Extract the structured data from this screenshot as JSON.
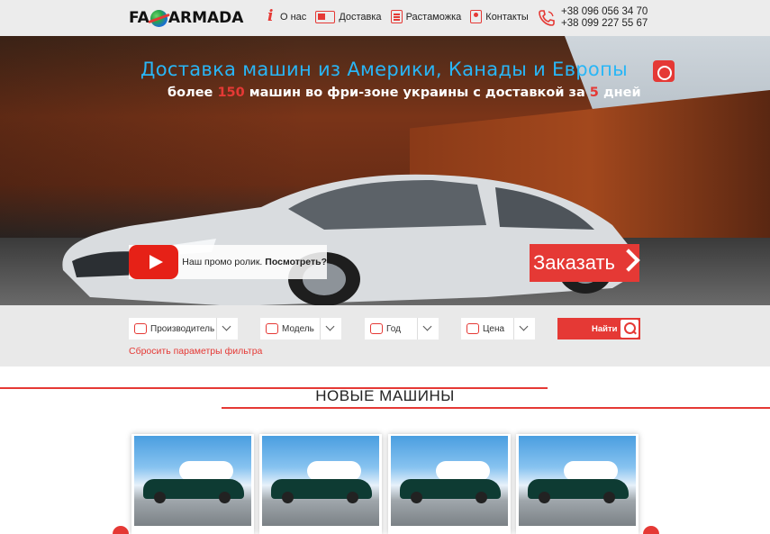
{
  "header": {
    "logo_left": "FA",
    "logo_right": "ARMADA",
    "nav": [
      {
        "label": "О нас",
        "icon": "info-icon"
      },
      {
        "label": "Доставка",
        "icon": "truck-icon"
      },
      {
        "label": "Растаможка",
        "icon": "customs-icon"
      },
      {
        "label": "Контакты",
        "icon": "contacts-icon"
      }
    ],
    "phone_1": "+38 096 056 34 70",
    "phone_2": "+38 099 227 55 67"
  },
  "hero": {
    "title": "Доставка машин из Америки, Канады и Европы",
    "subtitle_part1": "более ",
    "subtitle_count": "150",
    "subtitle_part2": " машин во фри-зоне украины с доставкой за ",
    "subtitle_days": "5",
    "subtitle_part3": " дней",
    "promo_text": "Наш промо ролик. ",
    "promo_link": "Посмотреть?",
    "order_label": "Заказать"
  },
  "filter": {
    "manufacturer": "Производитель",
    "model": "Модель",
    "year": "Год",
    "price": "Цена",
    "find_label": "Найти",
    "reset_label": "Сбросить параметры фильтра"
  },
  "section": {
    "title": "НОВЫЕ МАШИНЫ"
  },
  "colors": {
    "accent": "#e53935",
    "title_blue": "#29b6f6",
    "header_bg": "#ececec",
    "filter_bg": "#e9e9e9"
  }
}
